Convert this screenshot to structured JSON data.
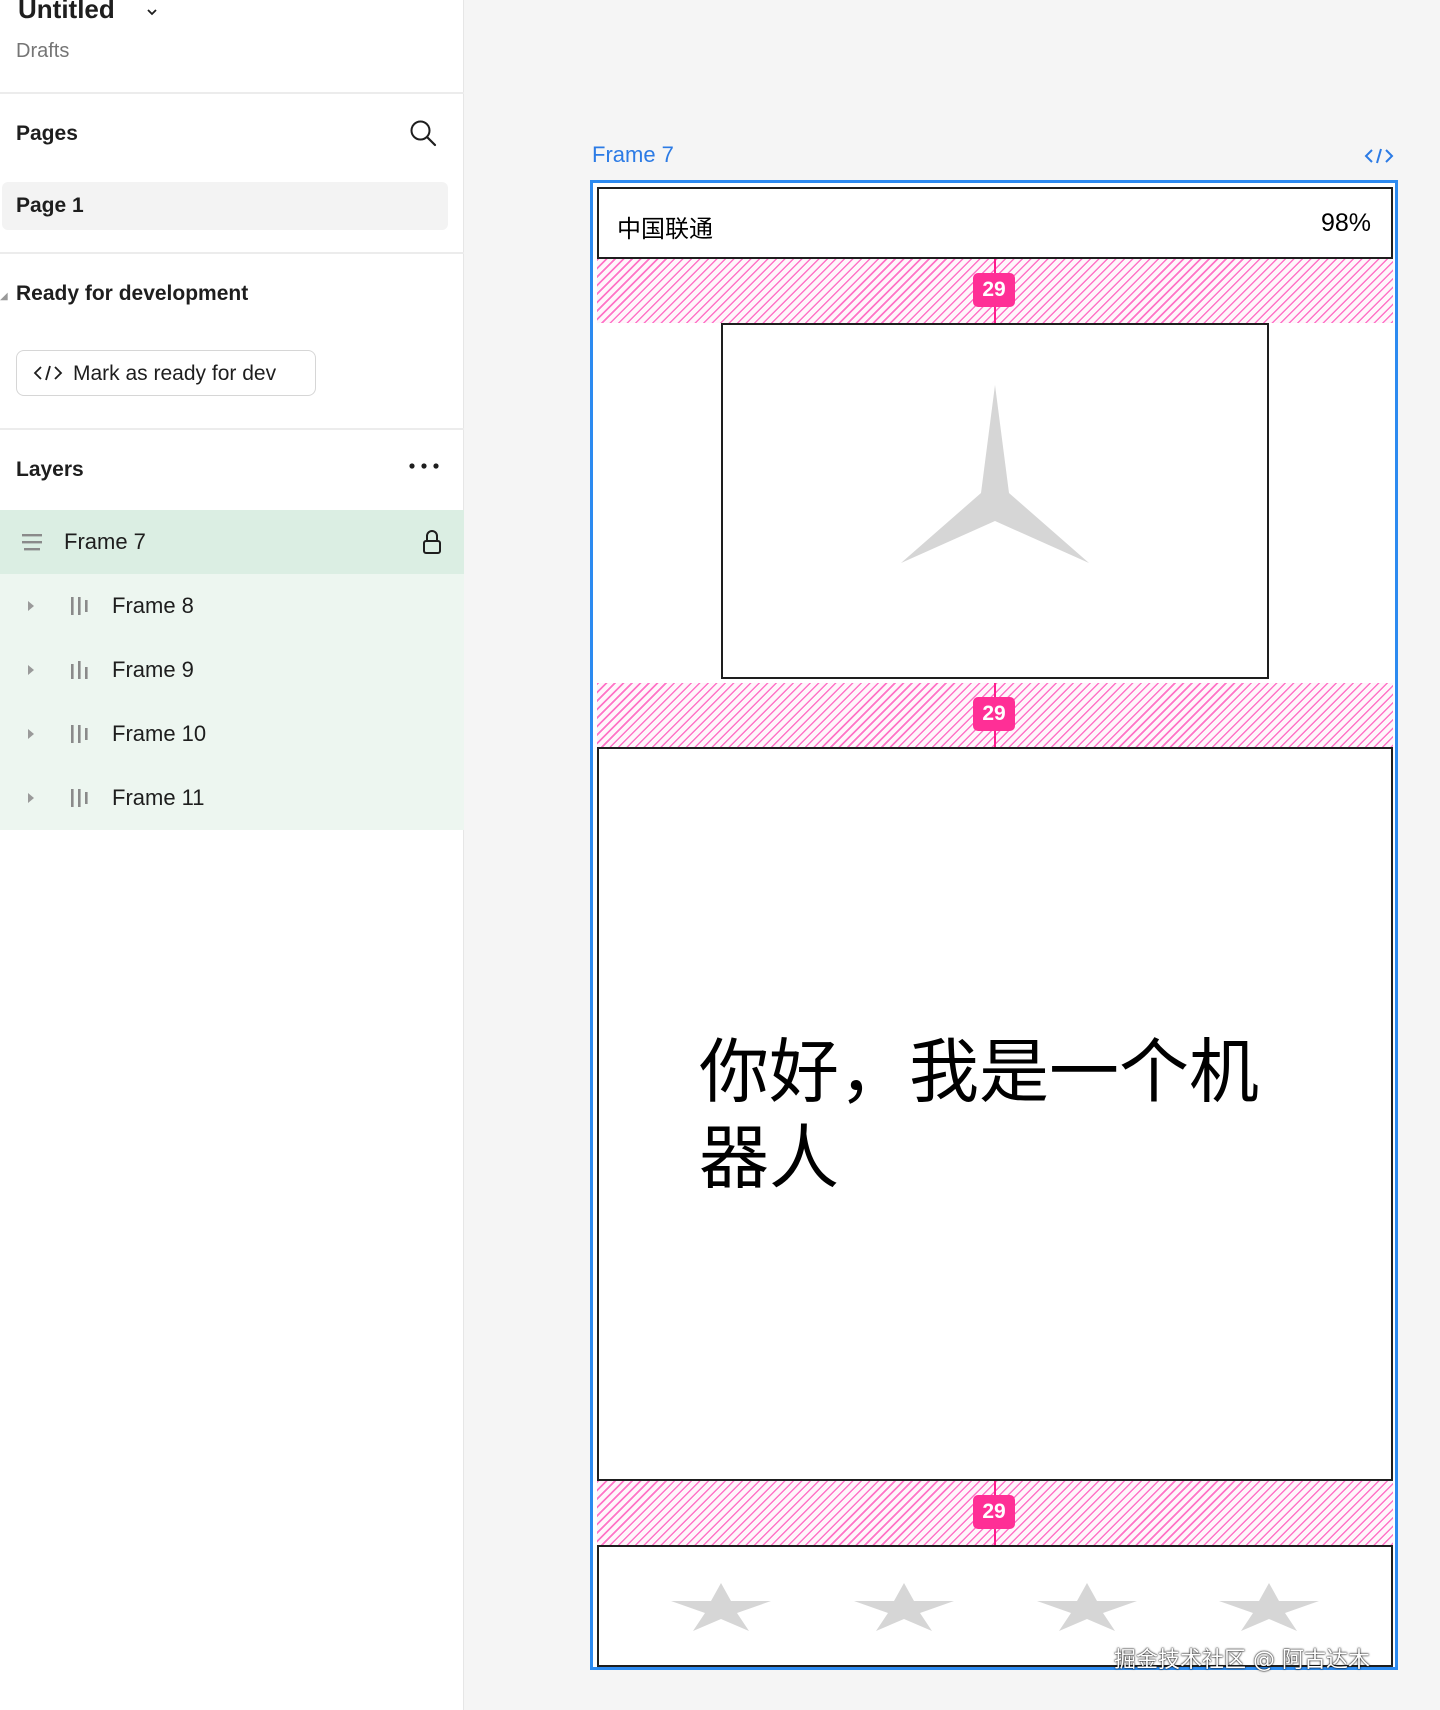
{
  "file": {
    "title": "Untitled",
    "subtitle": "Drafts"
  },
  "pages": {
    "title": "Pages",
    "items": [
      {
        "label": "Page 1"
      }
    ]
  },
  "ready_for_dev": {
    "title": "Ready for development",
    "button_label": "Mark as ready for dev"
  },
  "layers": {
    "title": "Layers",
    "selected": {
      "label": "Frame 7"
    },
    "children": [
      {
        "label": "Frame 8"
      },
      {
        "label": "Frame 9"
      },
      {
        "label": "Frame 10"
      },
      {
        "label": "Frame 11"
      }
    ]
  },
  "canvas": {
    "frame_label": "Frame 7",
    "status_bar": {
      "carrier": "中国联通",
      "battery": "98%"
    },
    "gap_value": "29",
    "message": "你好，我是一个机器人",
    "watermark": "掘金技术社区 @ 阿古达木"
  },
  "colors": {
    "selection_blue": "#2c8af0",
    "spacing_pink": "#ff2f96",
    "layer_selected": "#dbeee3",
    "layer_children": "#edf6f0"
  }
}
